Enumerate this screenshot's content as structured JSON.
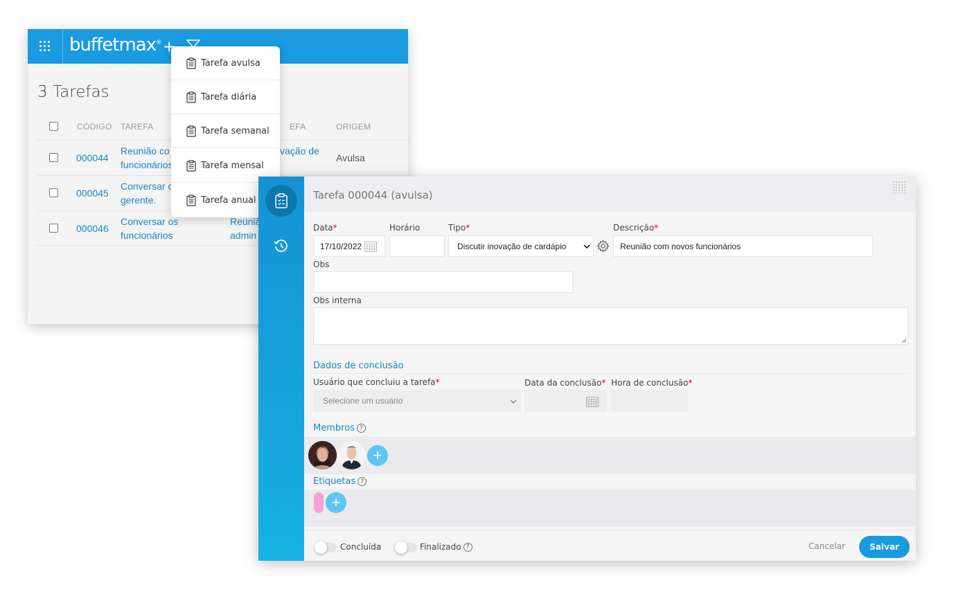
{
  "app": {
    "logo_text": "buffetmax",
    "logo_mark": "®",
    "page_title": "3 Tarefas"
  },
  "table": {
    "columns": [
      "CÓDIGO",
      "TAREFA",
      "EFA",
      "ORIGEM"
    ],
    "rows": [
      {
        "code": "000044",
        "task_line1": "Reunião co",
        "task_line2": "funcionários",
        "type_partial": "vação de",
        "origin": "Avulsa"
      },
      {
        "code": "000045",
        "task_line1": "Conversar c",
        "task_line2": "gerente."
      },
      {
        "code": "000046",
        "task_line1": "Conversar os",
        "task_line2": "funcionários",
        "type_line1": "Reuniã",
        "type_line2": "admin"
      }
    ]
  },
  "new_menu": {
    "items": [
      "Tarefa avulsa",
      "Tarefa diária",
      "Tarefa semanal",
      "Tarefa mensal",
      "Tarefa anual"
    ]
  },
  "form": {
    "title": "Tarefa 000044 (avulsa)",
    "data_label": "Data",
    "data_value": "17/10/2022",
    "horario_label": "Horário",
    "horario_value": "",
    "tipo_label": "Tipo",
    "tipo_value": "Discutir inovação de cardápio",
    "descricao_label": "Descrição",
    "descricao_value": "Reunião com novos funcionários",
    "obs_label": "Obs",
    "obs_value": "",
    "obs_interna_label": "Obs interna",
    "obs_interna_value": "",
    "required_mark": "*"
  },
  "conclusion": {
    "section_title": "Dados de conclusão",
    "user_label": "Usuário que concluiu a tarefa",
    "user_placeholder": "Selecione um usuário",
    "date_label": "Data da conclusão",
    "time_label": "Hora de conclusão"
  },
  "members": {
    "title": "Membros",
    "help": "?",
    "add": "+"
  },
  "tags": {
    "title": "Etiquetas",
    "help": "?",
    "add": "+",
    "tag_color": "#f6a3d8"
  },
  "footer": {
    "concluida_label": "Concluída",
    "finalizado_label": "Finalizado",
    "help": "?",
    "cancel_label": "Cancelar",
    "save_label": "Salvar"
  },
  "colors": {
    "brand_blue": "#1a9be0",
    "link_blue": "#1a86c8",
    "required_red": "#d0021b"
  }
}
